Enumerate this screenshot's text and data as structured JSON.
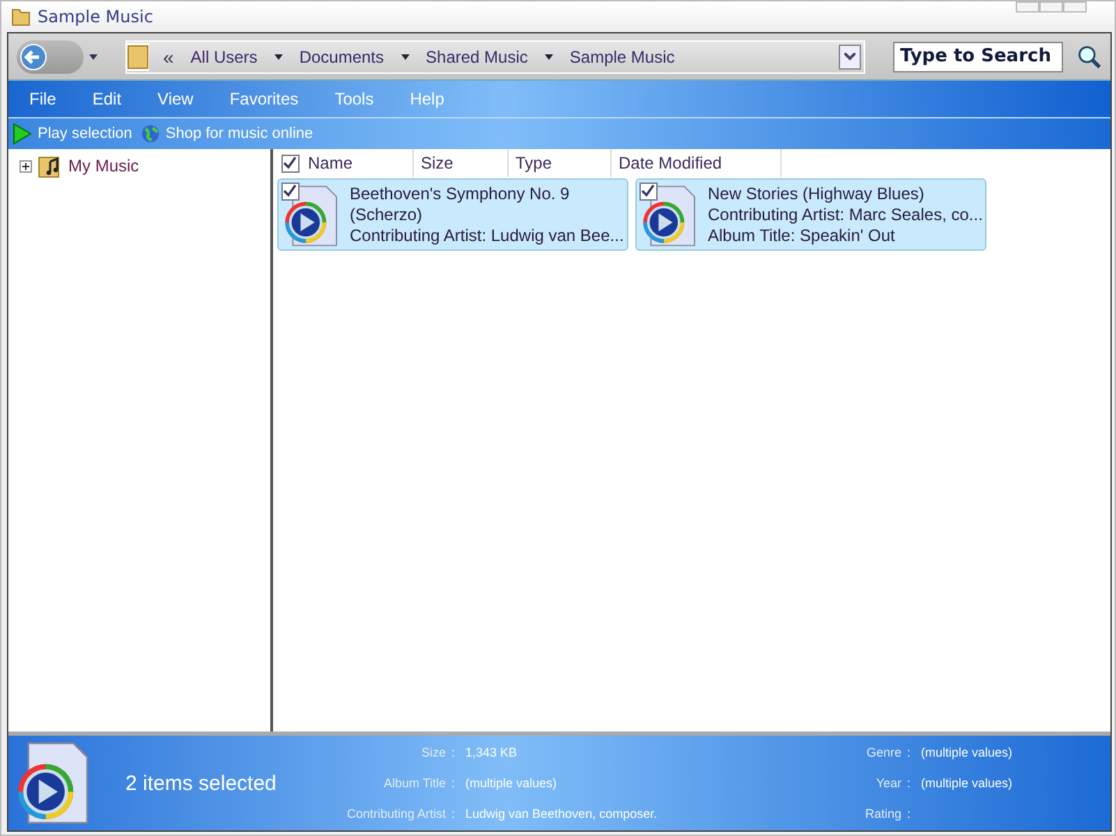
{
  "window": {
    "title": "Sample Music"
  },
  "address": {
    "overflow": "«",
    "crumbs": [
      "All Users",
      "Documents",
      "Shared Music",
      "Sample Music"
    ]
  },
  "search": {
    "placeholder": "Type to Search"
  },
  "menu": [
    "File",
    "Edit",
    "View",
    "Favorites",
    "Tools",
    "Help"
  ],
  "commands": [
    {
      "label": "Play selection",
      "kind": "play"
    },
    {
      "label": "Shop for music online",
      "kind": "globe"
    }
  ],
  "tree": [
    {
      "label": "My Music",
      "expanded": false
    }
  ],
  "columns": {
    "checked": true,
    "labels": [
      "Name",
      "Size",
      "Type",
      "Date Modified"
    ]
  },
  "files": [
    {
      "lines": [
        "Beethoven's Symphony No. 9",
        "(Scherzo)",
        "Contributing Artist: Ludwig van Bee..."
      ],
      "checked": true,
      "selected": true
    },
    {
      "lines": [
        "New Stories (Highway Blues)",
        "Contributing Artist: Marc Seales, co...",
        "Album Title: Speakin' Out"
      ],
      "checked": true,
      "selected": true
    }
  ],
  "details": {
    "summary": "2 items selected",
    "columns": [
      [
        {
          "label": "Size",
          "colon": ":",
          "value": "1,343 KB"
        },
        {
          "label": "Album Title",
          "colon": ":",
          "value": "(multiple values)"
        },
        {
          "label": "Contributing Artist",
          "colon": ":",
          "value": "Ludwig van Beethoven, composer."
        }
      ],
      [
        {
          "label": "Genre",
          "colon": ":",
          "value": "(multiple values)"
        },
        {
          "label": "Year",
          "colon": ":",
          "value": "(multiple values)"
        },
        {
          "label": "Rating",
          "colon": ":"
        }
      ]
    ]
  }
}
